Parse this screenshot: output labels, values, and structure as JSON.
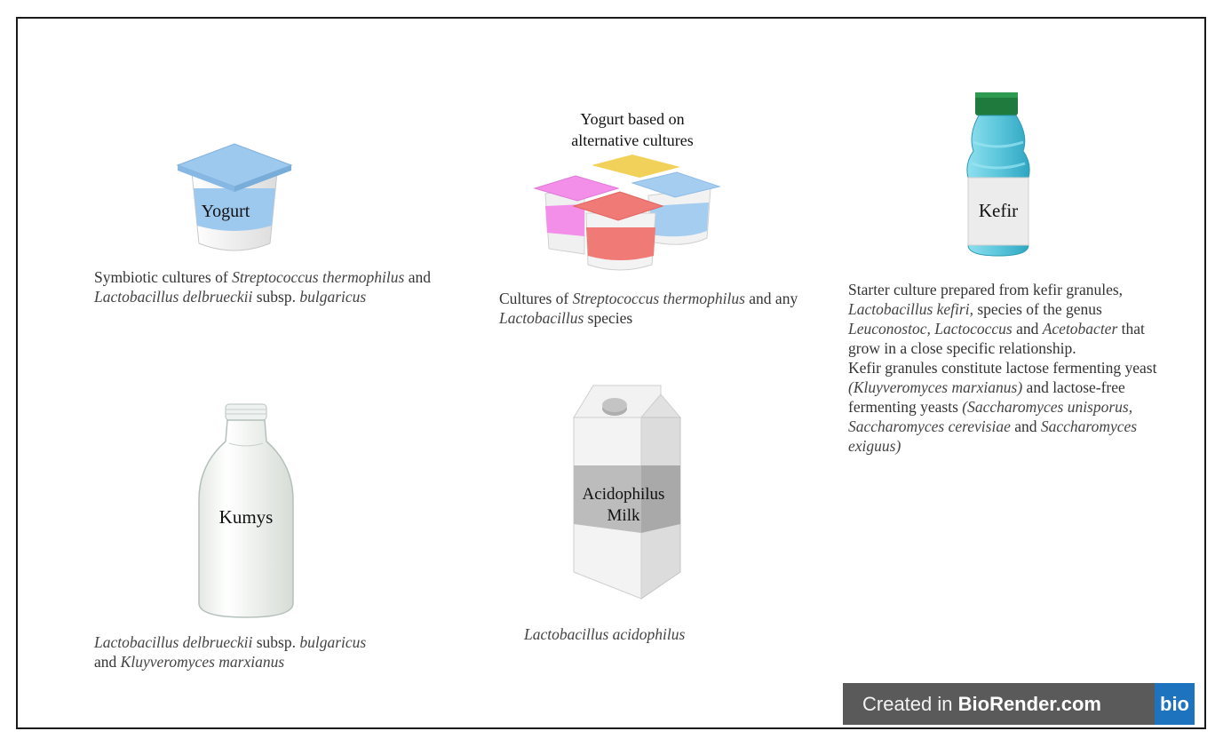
{
  "items": {
    "yogurt": {
      "label": "Yogurt",
      "caption": {
        "p1": "Symbiotic cultures of ",
        "i1": "Streptococcus thermophilus",
        "p2": " and ",
        "i2": "Lactobacillus delbrueckii",
        "p3": " subsp. ",
        "i3": "bulgaricus"
      }
    },
    "alt_yogurt": {
      "label_line1": "Yogurt based on",
      "label_line2": "alternative cultures",
      "caption": {
        "p1": "Cultures of ",
        "i1": "Streptococcus thermophilus",
        "p2": " and any ",
        "i2": "Lactobacillus",
        "p3": " species"
      }
    },
    "kefir": {
      "label": "Kefir",
      "caption": {
        "p1": "Starter culture prepared from kefir granules, ",
        "i1": "Lactobacillus kefiri,",
        "p2": " species of the genus ",
        "i2": "Leuconostoc, Lactococcus",
        "p3": " and ",
        "i3": "Acetobacter",
        "p4": " that grow in a close specific relationship.",
        "p5": "Kefir granules constitute lactose fermenting yeast ",
        "i4": "(Kluyveromyces marxianus)",
        "p6": " and lactose-free fermenting yeasts ",
        "i5": "(Saccharomyces unisporus, Saccharomyces cerevisiae",
        "p7": " and ",
        "i6": "Saccharomyces exiguus)"
      }
    },
    "kumys": {
      "label": "Kumys",
      "caption": {
        "i1": "Lactobacillus delbrueckii",
        "p1": " subsp. ",
        "i2": "bulgaricus",
        "p2": " and ",
        "i3": "Kluyveromyces marxianus"
      }
    },
    "acidophilus": {
      "label_line1": "Acidophilus",
      "label_line2": "Milk",
      "caption": {
        "i1": "Lactobacillus acidophilus"
      }
    }
  },
  "badge": {
    "prefix": "Created in ",
    "brand": "BioRender.com",
    "logo": "bio"
  },
  "colors": {
    "yogurt_blue": "#9ec9ef",
    "kefir_cyan": "#5cc6dc",
    "kefir_cap": "#1f7a3e",
    "pink": "#f38ee9",
    "yellow": "#f2d15b",
    "red": "#f07a76",
    "light_blue": "#a5cdf0",
    "biorender_blue": "#1e73be"
  }
}
